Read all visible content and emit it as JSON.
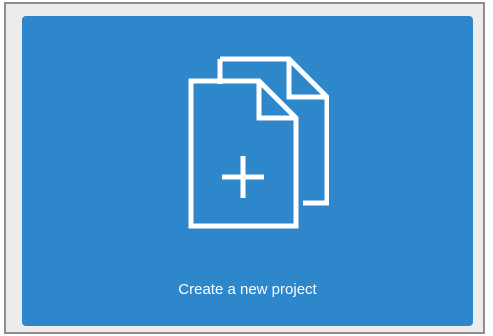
{
  "card": {
    "label": "Create a new project",
    "icon": "new-project-documents-icon",
    "background_color": "#2e86cb",
    "text_color": "#ffffff"
  }
}
